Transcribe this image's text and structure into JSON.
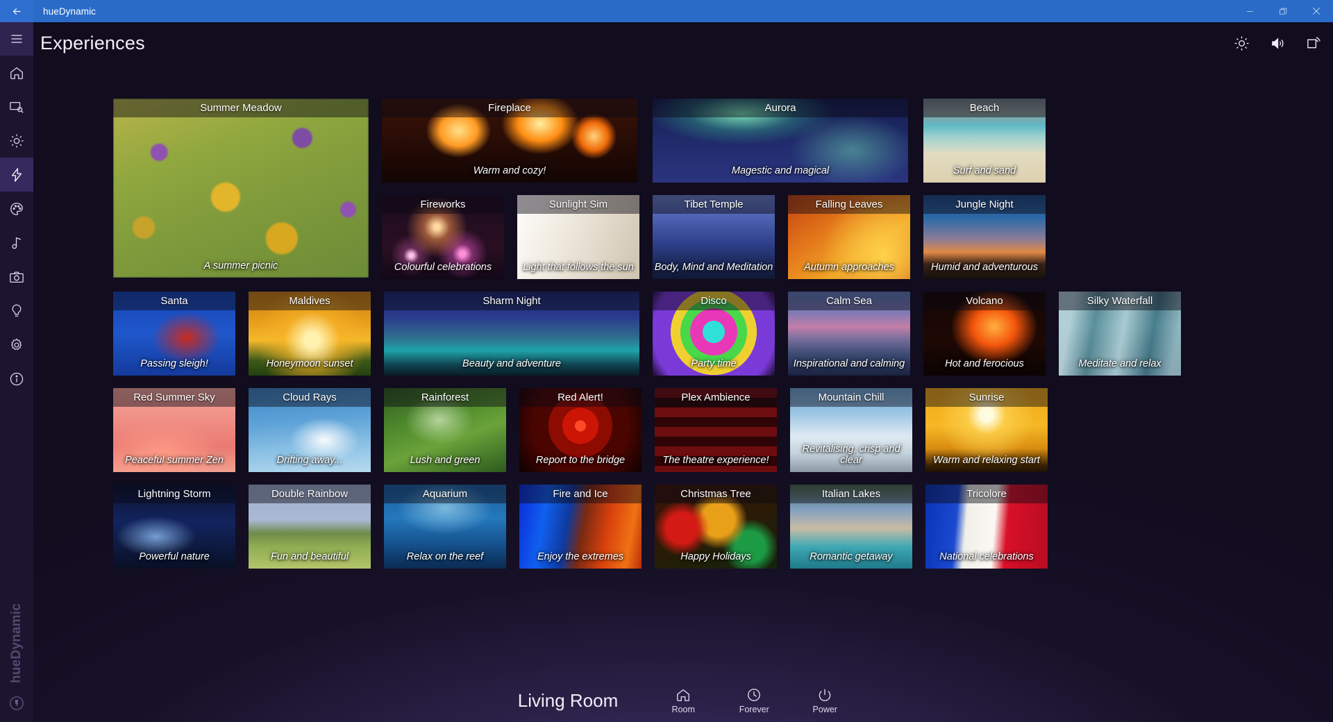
{
  "window": {
    "title": "hueDynamic",
    "back_icon": "back-arrow-icon",
    "minimize_label": "–",
    "restore_label": "❐",
    "close_label": "✕"
  },
  "header": {
    "title": "Experiences",
    "menu_icon": "hamburger-menu-icon",
    "actions": [
      {
        "icon": "brightness-icon",
        "name": "brightness-button"
      },
      {
        "icon": "volume-icon",
        "name": "volume-button"
      },
      {
        "icon": "cast-icon",
        "name": "cast-button"
      }
    ]
  },
  "sidebar": {
    "brand": "hueDynamic",
    "items": [
      {
        "icon": "home-icon",
        "name": "sidebar-item-home",
        "active": false
      },
      {
        "icon": "screen-scan-icon",
        "name": "sidebar-item-screen",
        "active": false
      },
      {
        "icon": "brightness-icon",
        "name": "sidebar-item-brightness",
        "active": false
      },
      {
        "icon": "lightning-icon",
        "name": "sidebar-item-experiences",
        "active": true
      },
      {
        "icon": "palette-icon",
        "name": "sidebar-item-colours",
        "active": false
      },
      {
        "icon": "music-note-icon",
        "name": "sidebar-item-music",
        "active": false
      },
      {
        "icon": "camera-icon",
        "name": "sidebar-item-camera",
        "active": false
      },
      {
        "icon": "bulb-icon",
        "name": "sidebar-item-lights",
        "active": false
      },
      {
        "icon": "gear-icon",
        "name": "sidebar-item-settings",
        "active": false
      },
      {
        "icon": "info-icon",
        "name": "sidebar-item-about",
        "active": false
      }
    ]
  },
  "tiles": {
    "summer_meadow": {
      "title": "Summer Meadow",
      "subtitle": "A summer picnic"
    },
    "fireplace": {
      "title": "Fireplace",
      "subtitle": "Warm and cozy!"
    },
    "aurora": {
      "title": "Aurora",
      "subtitle": "Magestic and magical"
    },
    "beach": {
      "title": "Beach",
      "subtitle": "Surf and sand"
    },
    "fireworks": {
      "title": "Fireworks",
      "subtitle": "Colourful celebrations"
    },
    "sunlight_sim": {
      "title": "Sunlight Sim",
      "subtitle": "Light that follows the sun"
    },
    "tibet_temple": {
      "title": "Tibet Temple",
      "subtitle": "Body, Mind and Meditation"
    },
    "falling_leaves": {
      "title": "Falling Leaves",
      "subtitle": "Autumn approaches"
    },
    "jungle_night": {
      "title": "Jungle Night",
      "subtitle": "Humid and adventurous"
    },
    "santa": {
      "title": "Santa",
      "subtitle": "Passing sleigh!"
    },
    "maldives": {
      "title": "Maldives",
      "subtitle": "Honeymoon sunset"
    },
    "sharm_night": {
      "title": "Sharm Night",
      "subtitle": "Beauty and adventure"
    },
    "disco": {
      "title": "Disco",
      "subtitle": "Party time"
    },
    "calm_sea": {
      "title": "Calm Sea",
      "subtitle": "Inspirational and calming"
    },
    "volcano": {
      "title": "Volcano",
      "subtitle": "Hot and ferocious"
    },
    "silky_waterfall": {
      "title": "Silky Waterfall",
      "subtitle": "Meditate and relax"
    },
    "red_summer_sky": {
      "title": "Red Summer Sky",
      "subtitle": "Peaceful summer Zen"
    },
    "cloud_rays": {
      "title": "Cloud Rays",
      "subtitle": "Drifting away..."
    },
    "rainforest": {
      "title": "Rainforest",
      "subtitle": "Lush and green"
    },
    "red_alert": {
      "title": "Red Alert!",
      "subtitle": "Report to the bridge"
    },
    "plex_ambience": {
      "title": "Plex Ambience",
      "subtitle": "The theatre experience!"
    },
    "mountain_chill": {
      "title": "Mountain Chill",
      "subtitle": "Revitalising, crisp and clear"
    },
    "sunrise": {
      "title": "Sunrise",
      "subtitle": "Warm and relaxing start"
    },
    "lightning_storm": {
      "title": "Lightning Storm",
      "subtitle": "Powerful nature"
    },
    "double_rainbow": {
      "title": "Double Rainbow",
      "subtitle": "Fun and beautiful"
    },
    "aquarium": {
      "title": "Aquarium",
      "subtitle": "Relax on the reef"
    },
    "fire_and_ice": {
      "title": "Fire and Ice",
      "subtitle": "Enjoy the extremes"
    },
    "christmas_tree": {
      "title": "Christmas Tree",
      "subtitle": "Happy Holidays"
    },
    "italian_lakes": {
      "title": "Italian Lakes",
      "subtitle": "Romantic getaway"
    },
    "tricolore": {
      "title": "Tricolore",
      "subtitle": "National celebrations"
    }
  },
  "bottombar": {
    "room": "Living Room",
    "buttons": [
      {
        "label": "Room",
        "icon": "home-icon"
      },
      {
        "label": "Forever",
        "icon": "clock-icon"
      },
      {
        "label": "Power",
        "icon": "power-icon"
      }
    ]
  },
  "colors": {
    "titlebar": "#2a6bc8",
    "sidebar": "#1c1530",
    "sidebar_active": "#36295e",
    "background": "#110c1e",
    "glow": "#4c3a7e"
  }
}
